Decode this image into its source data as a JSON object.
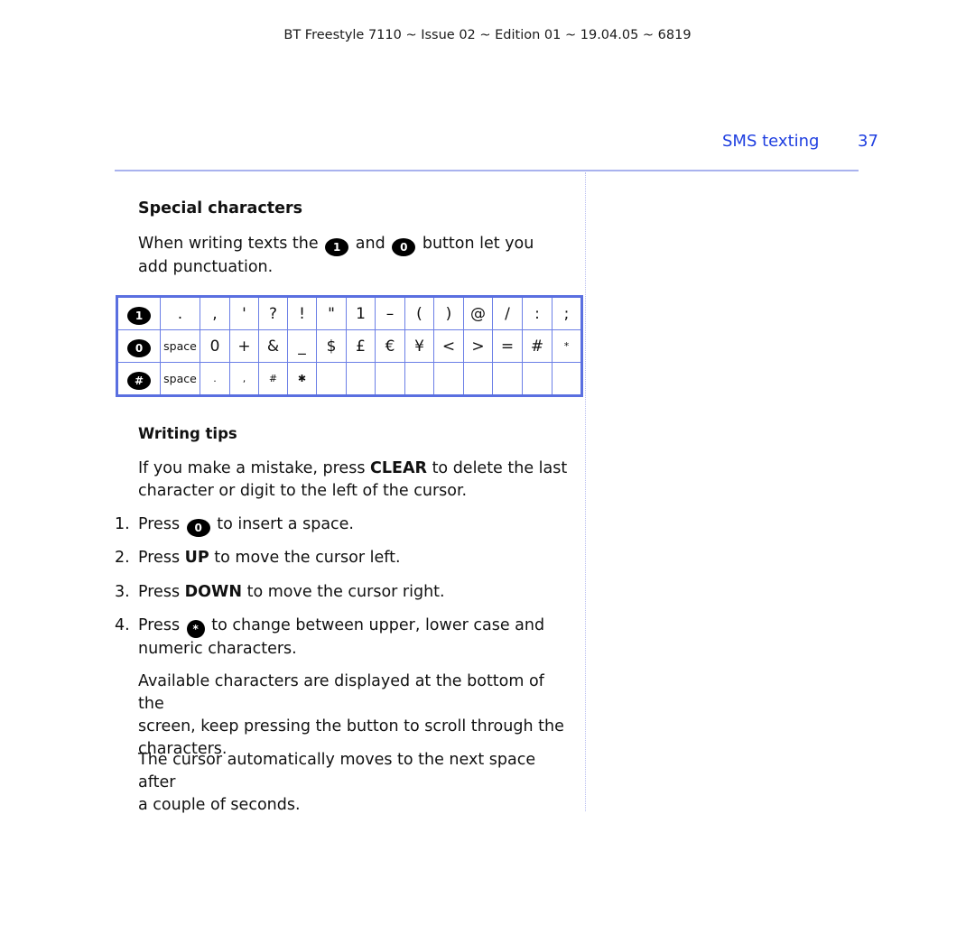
{
  "running_header": "BT Freestyle 7110 ~ Issue 02 ~ Edition 01 ~ 19.04.05 ~ 6819",
  "section_title": "SMS texting",
  "page_number": "37",
  "special": {
    "heading": "Special characters",
    "intro_before": "When writing texts the",
    "key1": "1",
    "intro_and": "and",
    "key0": "0",
    "intro_after": "button let you",
    "intro_line2": "add punctuation."
  },
  "char_table": {
    "rows": [
      {
        "key": "1",
        "key_icon": "key-1-icon",
        "cells": [
          ".",
          ",",
          "'",
          "?",
          "!",
          "\"",
          "1",
          "–",
          "(",
          ")",
          "@",
          "/",
          ":",
          ";"
        ]
      },
      {
        "key": "0",
        "key_icon": "key-0-icon",
        "cells": [
          "space",
          "0",
          "+",
          "&",
          "_",
          "$",
          "£",
          "€",
          "¥",
          "<",
          ">",
          "=",
          "#",
          "*"
        ]
      },
      {
        "key": "#",
        "key_icon": "key-hash-icon",
        "cells": [
          "space",
          ".",
          ",",
          "#",
          "✱",
          "",
          "",
          "",
          "",
          "",
          "",
          "",
          "",
          ""
        ]
      }
    ]
  },
  "writing_tips": {
    "heading": "Writing tips",
    "para1_a": "If you make a mistake, press",
    "para1_b": "CLEAR",
    "para1_c": "to delete the last",
    "para1_line2": "character or digit to the left of the cursor.",
    "steps": [
      {
        "n": "1.",
        "pre": "Press",
        "key": "0",
        "bold": "",
        "post": "to insert a space."
      },
      {
        "n": "2.",
        "pre": "Press",
        "key": "",
        "bold": "UP",
        "post": "to move the cursor left."
      },
      {
        "n": "3.",
        "pre": "Press",
        "key": "",
        "bold": "DOWN",
        "post": "to move the cursor right."
      },
      {
        "n": "4.",
        "pre": "Press",
        "key": "*",
        "bold": "",
        "post": "to change between upper, lower case and",
        "line2": "numeric characters."
      }
    ],
    "para2_l1": "Available characters are displayed at the bottom of the",
    "para2_l2": "screen, keep pressing the button to scroll through the",
    "para2_l3": "characters.",
    "para3_l1": "The cursor automatically moves to the next space after",
    "para3_l2": "a couple of seconds."
  }
}
